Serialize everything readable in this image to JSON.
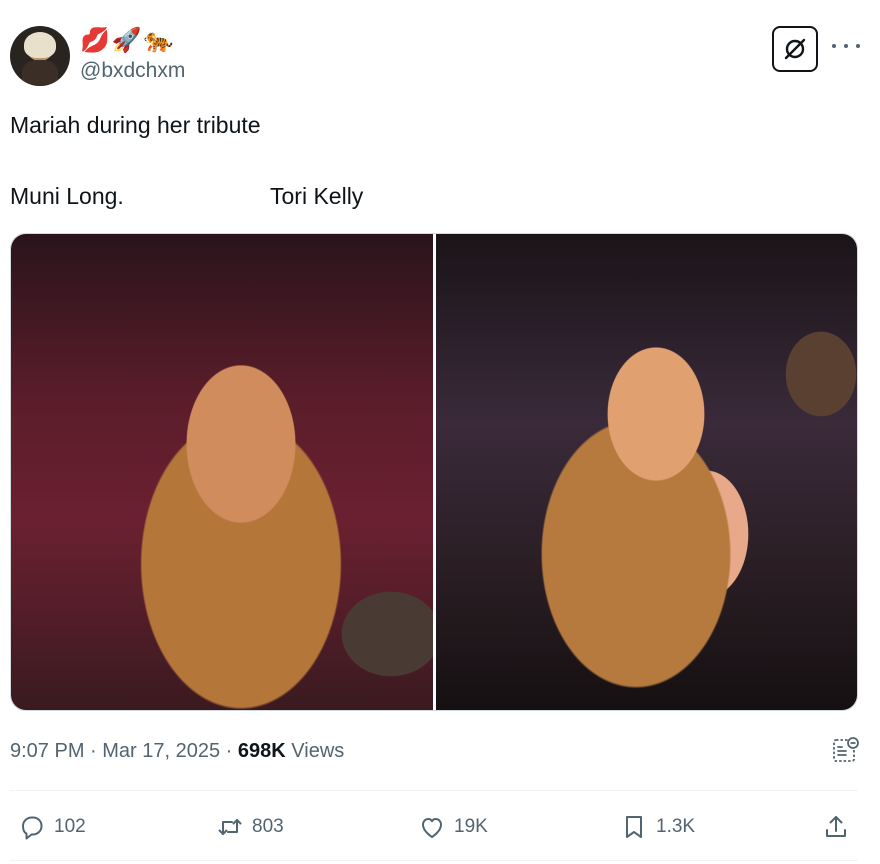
{
  "author": {
    "display_name": "💋🚀🐅",
    "handle": "@bxdchxm"
  },
  "tweet": {
    "text": "Mariah during her tribute",
    "caption_left": "Muni Long.",
    "caption_right": "Tori Kelly"
  },
  "timestamp": {
    "time": "9:07 PM",
    "sep1": " · ",
    "date": "Mar 17, 2025",
    "sep2": " · ",
    "views_count": "698K",
    "views_label": " Views"
  },
  "actions": {
    "replies": "102",
    "reposts": "803",
    "likes": "19K",
    "bookmarks": "1.3K"
  },
  "icons": [
    "grok-icon",
    "more-icon",
    "edit-history-icon",
    "reply-icon",
    "repost-icon",
    "like-icon",
    "bookmark-icon",
    "share-icon"
  ],
  "colors": {
    "text": "#0f1419",
    "secondary": "#536471",
    "divider": "#eff3f4"
  }
}
